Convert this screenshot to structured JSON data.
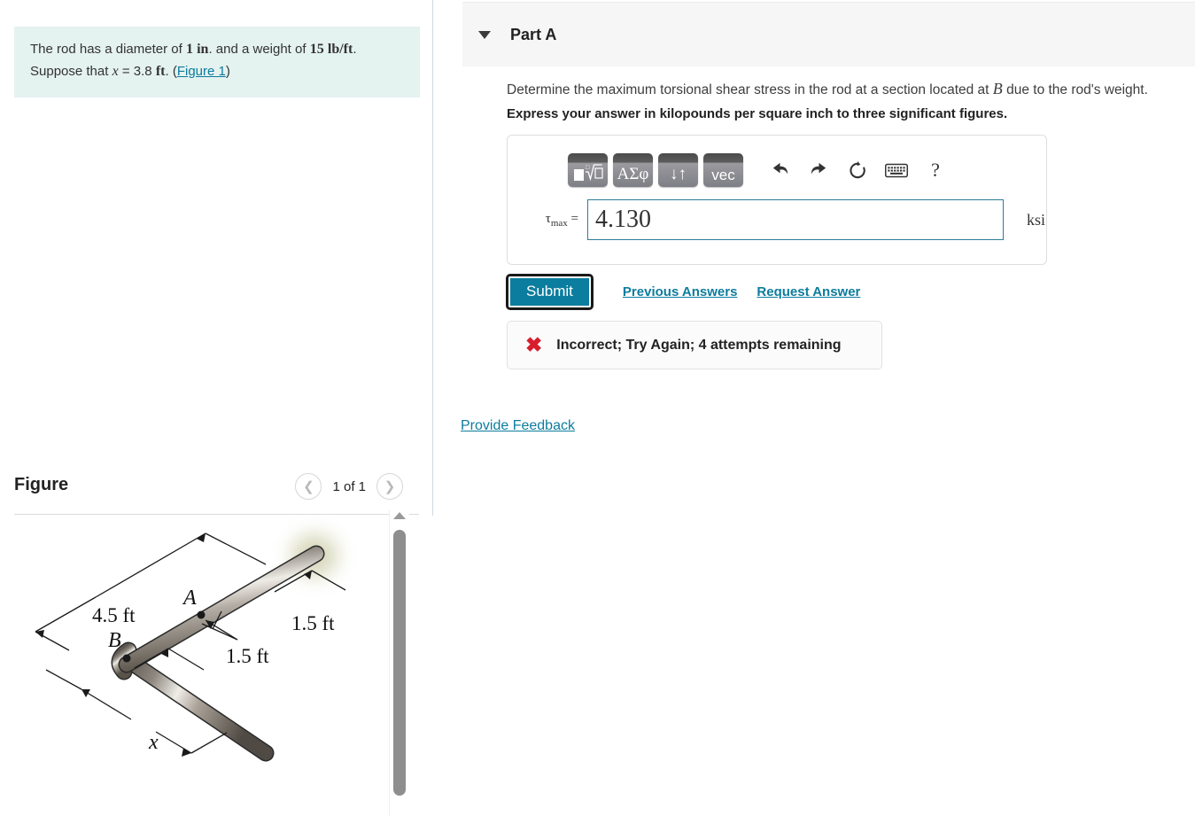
{
  "problem": {
    "line1_a": "The rod has a diameter of ",
    "line1_d": "1",
    "line1_unit": "in",
    "line1_b": ". and a weight of ",
    "line1_w": "15",
    "line1_wunit": "lb/ft",
    "line1_c": ".",
    "line2_a": "Suppose that ",
    "line2_var": "x",
    "line2_eq": " = ",
    "line2_val": "3.8",
    "line2_unit": "ft",
    "line2_b": ". (",
    "figure_link": "Figure 1",
    "line2_c": ")"
  },
  "figure": {
    "title": "Figure",
    "pager_label": "1 of 1",
    "prev_icon": "chevron-left-icon",
    "next_icon": "chevron-right-icon",
    "scrollbar_up_icon": "scroll-up-arrow-icon",
    "labels": {
      "dim_long": "4.5 ft",
      "dim_tip": "1.5 ft",
      "dim_mid": "1.5 ft",
      "dim_x": "x",
      "point_a": "A",
      "point_b": "B"
    }
  },
  "part": {
    "caret_icon": "caret-down-icon",
    "title": "Part A",
    "question_a": "Determine the maximum torsional shear stress in the rod at a section located at ",
    "question_var": "B",
    "question_b": " due to the rod's weight.",
    "express": "Express your answer in kilopounds per square inch to three significant figures."
  },
  "toolbar": {
    "templates_label": "■√□",
    "greek_label": "ΑΣφ",
    "arrows_label": "↓↑",
    "vec_label": "vec",
    "undo_icon": "undo-arrow-icon",
    "redo_icon": "redo-arrow-icon",
    "reset_icon": "reset-circular-arrow-icon",
    "keyboard_icon": "keyboard-icon",
    "help_label": "?"
  },
  "answer": {
    "label_tau": "τ",
    "label_sub": "max",
    "label_eq": "=",
    "value": "4.130",
    "placeholder": "",
    "unit": "ksi"
  },
  "actions": {
    "submit_label": "Submit",
    "previous_answers_label": "Previous Answers",
    "request_answer_label": "Request Answer",
    "provide_feedback_label": "Provide Feedback"
  },
  "feedback": {
    "x_icon": "✖",
    "message": "Incorrect; Try Again; 4 attempts remaining"
  },
  "colors": {
    "accent_teal": "#0b7d9e",
    "link_teal": "#0c7c9d",
    "problem_bg": "#e4f2f0",
    "error_red": "#d81e2c",
    "header_gray": "#f6f6f6"
  }
}
